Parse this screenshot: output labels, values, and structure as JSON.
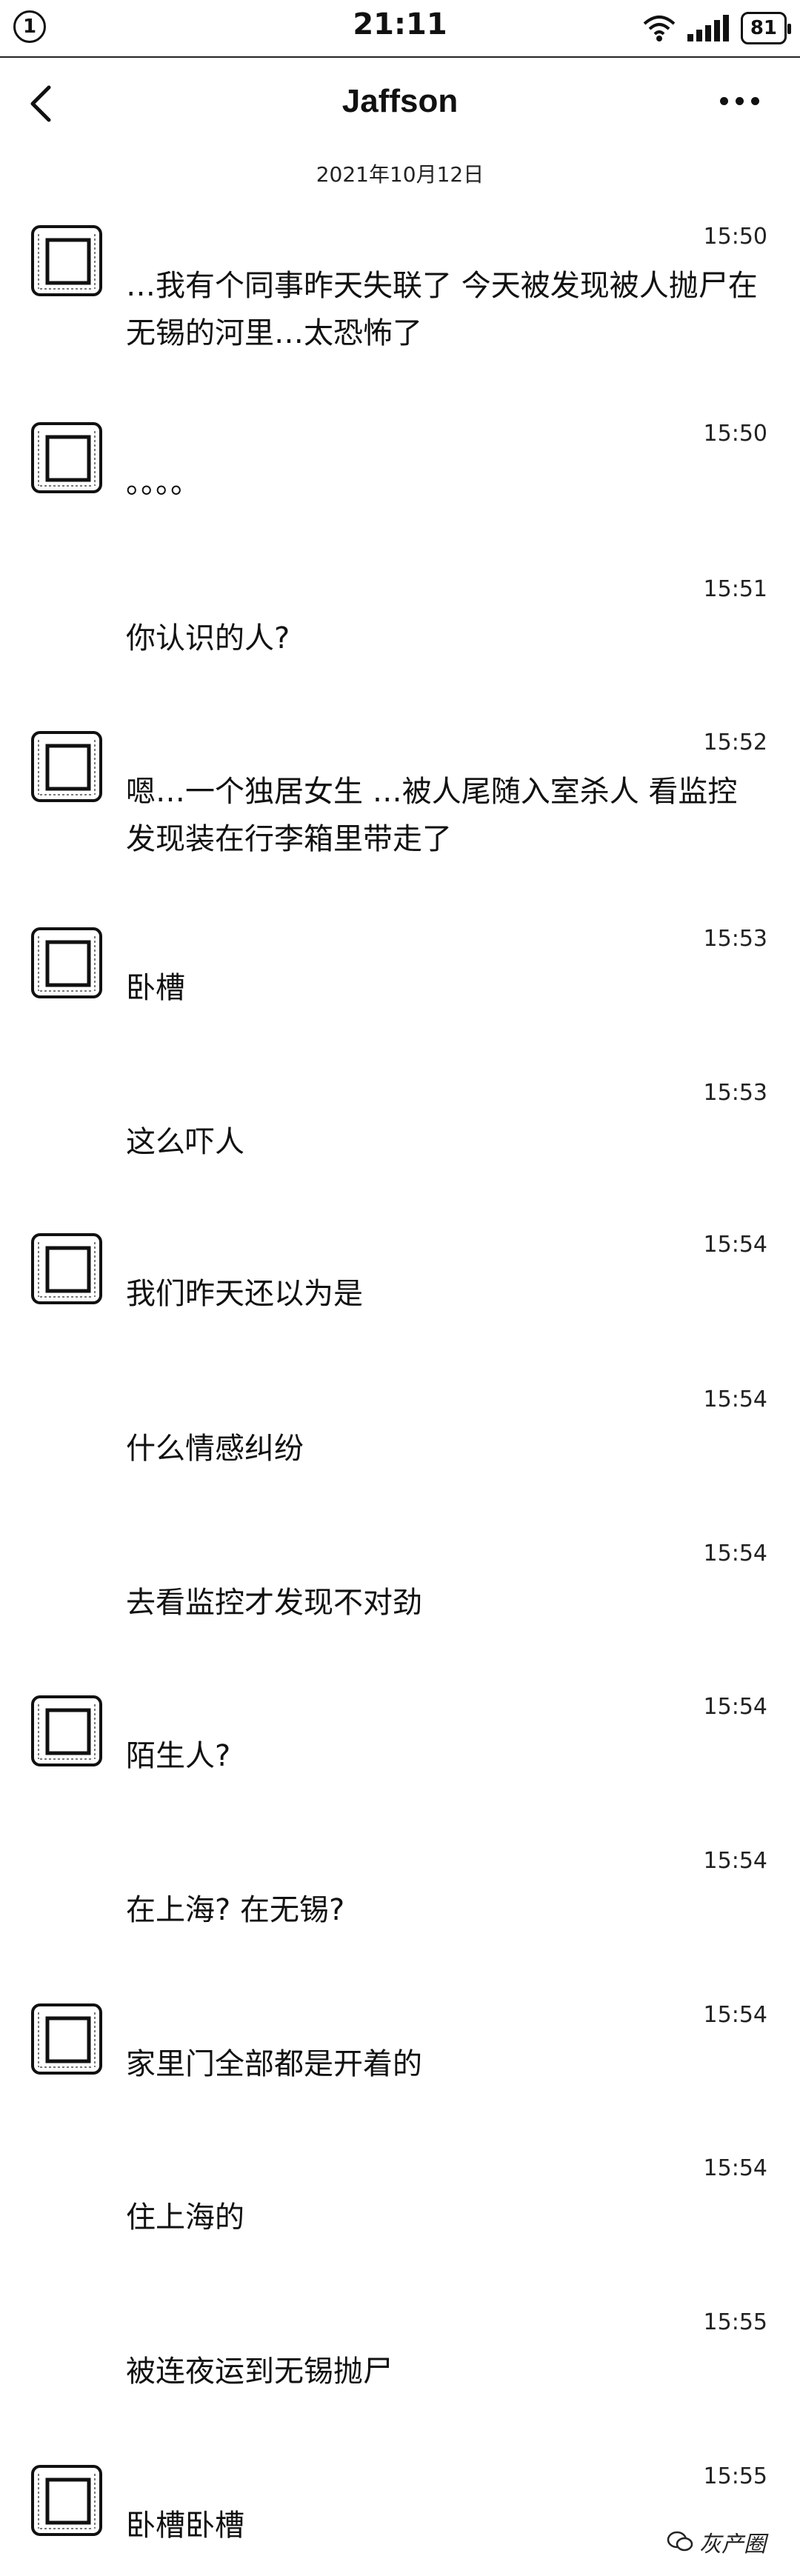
{
  "status_bar": {
    "notification_count": "1",
    "time": "21:11",
    "battery": "81"
  },
  "header": {
    "title": "Jaffson"
  },
  "date_label": "2021年10月12日",
  "messages": [
    {
      "time": "15:50",
      "sender": "",
      "text": "…我有个同事昨天失联了 今天被发现被人抛尸在无锡的河里…太恐怖了",
      "avatar": true
    },
    {
      "time": "15:50",
      "sender": "",
      "text": "。。。。",
      "avatar": true
    },
    {
      "time": "15:51",
      "sender": "",
      "text": "你认识的人?",
      "avatar": false
    },
    {
      "time": "15:52",
      "sender": "",
      "text": "嗯…一个独居女生 …被人尾随入室杀人 看监控发现装在行李箱里带走了",
      "avatar": true
    },
    {
      "time": "15:53",
      "sender": "",
      "text": "卧槽",
      "avatar": true
    },
    {
      "time": "15:53",
      "sender": "",
      "text": "这么吓人",
      "avatar": false
    },
    {
      "time": "15:54",
      "sender": "",
      "text": "我们昨天还以为是",
      "avatar": true
    },
    {
      "time": "15:54",
      "sender": "",
      "text": "什么情感纠纷",
      "avatar": false
    },
    {
      "time": "15:54",
      "sender": "",
      "text": "去看监控才发现不对劲",
      "avatar": false
    },
    {
      "time": "15:54",
      "sender": "",
      "text": "陌生人?",
      "avatar": true
    },
    {
      "time": "15:54",
      "sender": "",
      "text": "在上海? 在无锡?",
      "avatar": false
    },
    {
      "time": "15:54",
      "sender": "",
      "text": "家里门全部都是开着的",
      "avatar": true
    },
    {
      "time": "15:54",
      "sender": "",
      "text": "住上海的",
      "avatar": false
    },
    {
      "time": "15:55",
      "sender": "",
      "text": "被连夜运到无锡抛尸",
      "avatar": false
    },
    {
      "time": "15:55",
      "sender": "",
      "text": "卧槽卧槽",
      "avatar": true
    }
  ],
  "watermark": {
    "text": "灰产圈"
  }
}
